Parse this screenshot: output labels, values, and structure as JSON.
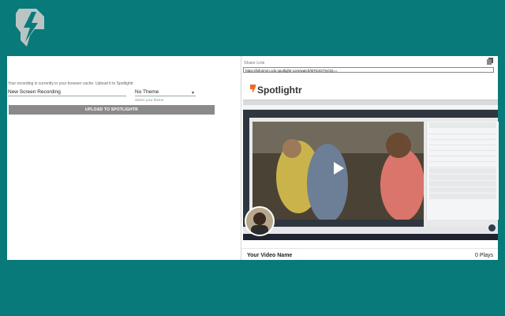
{
  "left": {
    "cache_message": "Your recording is currently in your browser cache. Upload it to Spotlightr",
    "recording_name": "New Screen Recording",
    "theme_value": "No Theme",
    "theme_help": "Select your theme",
    "upload_label": "UPLOAD TO SPOTLIGHTR"
  },
  "right": {
    "share_label": "Share Link",
    "share_url": "https://bifurimm.cdn.spotlightr.com/watch/MTE3OTIyOQ==",
    "brand_name": "Spotlightr",
    "video_name": "Your Video Name",
    "plays": "0 Plays"
  },
  "colors": {
    "background": "#087a7a",
    "brand_orange": "#f26b21",
    "button_gray": "#8a8a8a"
  },
  "icons": [
    "spotlightr-logo-icon",
    "copy-icon",
    "dropdown-caret-icon",
    "play-icon",
    "chat-icon"
  ]
}
